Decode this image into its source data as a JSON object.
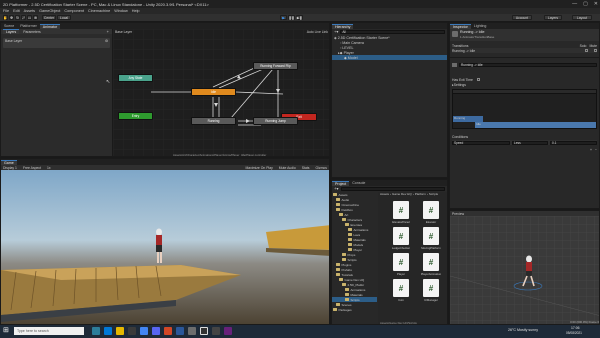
{
  "window": {
    "title": "2D Platformer - 2.5D Certification Starter Scene - PC, Mac & Linux Standalone - Unity 2020.3.9f1 Personal* <DX11>",
    "controls": [
      "—",
      "▢",
      "✕"
    ]
  },
  "menu": [
    "File",
    "Edit",
    "Assets",
    "GameObject",
    "Component",
    "Cinemachine",
    "Window",
    "Help"
  ],
  "toolbar": {
    "pivot": "Center",
    "space": "Local",
    "account": "Account",
    "layers": "Layers",
    "layout": "Layout"
  },
  "animator": {
    "tabs": [
      "Scene",
      "Platformer",
      "Animator"
    ],
    "subtabs": [
      "Layers",
      "Parameters"
    ],
    "base_layer_breadcrumb": "Base Layer",
    "layer_item": "Base Layer",
    "auto_live_link": "Auto Live Link",
    "path": "Assets/Art/Character/Animations/Player/Anims/Player_Idle/Player.controller",
    "states": {
      "any_state": "Any State",
      "entry": "Entry",
      "idle": "Idle",
      "exit": "Exit",
      "running": "Running",
      "running_jump": "Running Jump",
      "running_forward_flip": "Running Forward Flip"
    }
  },
  "hierarchy": {
    "tab": "Hierarchy",
    "search_placeholder": "All",
    "scene": "2.5D Certification Starter Scene*",
    "items": [
      "Main Camera",
      "LEVEL",
      "Player",
      "Model"
    ]
  },
  "inspector": {
    "tabs": [
      "Inspector",
      "Lighting"
    ],
    "header": "Running -> Idle",
    "sub_header": "1 AnimatorTransitionBase",
    "transitions_label": "Transitions",
    "solo_label": "Solo",
    "mute_label": "Mute",
    "transition_item": "Running -> Idle",
    "name_field": "Running -> Idle",
    "has_exit_time": "Has Exit Time",
    "settings": "Settings",
    "timeline_state_a": "Running",
    "timeline_state_b": "Idle",
    "conditions_label": "Conditions",
    "condition_param": "Speed",
    "condition_op": "Less",
    "condition_value": "0.1",
    "preview_label": "Preview",
    "preview_info": "0:00 (000.0%) Frame 0"
  },
  "game": {
    "tabs": [
      "Game"
    ],
    "display": "Display 1",
    "aspect": "Free Aspect",
    "scale": "1x",
    "options": [
      "Maximize On Play",
      "Mute Audio",
      "Stats",
      "Gizmos"
    ]
  },
  "project": {
    "tabs": [
      "Project",
      "Console"
    ],
    "breadcrumb": [
      "Assets",
      "Game Dev HQ",
      "Platform",
      "Scripts"
    ],
    "tree": [
      "Assets",
      "Audio",
      "Cinemachine",
      "Fieldbox",
      "Art",
      "Characters",
      "Enemies",
      "Animations",
      "Lava",
      "Materials",
      "Models",
      "Player",
      "Props",
      "Scripts",
      "Plugins",
      "Prefabs",
      "Tutorials",
      "Game Dev HQ",
      "2.5D_Platfor",
      "Animations",
      "Materials",
      "Scripts",
      "Scenes",
      "Packages"
    ],
    "assets": [
      "ElevatorPanel",
      "Elevator",
      "LedgeChecker",
      "MovingPlatform",
      "Player",
      "PlayerAnimation",
      "Coin",
      "UIManager"
    ],
    "status_path": "Assets/Game Dev HQ/Scripts"
  },
  "preview_window": {
    "label": "Preview",
    "info": "0:00 (000.0%) Frame 0"
  },
  "taskbar": {
    "search_placeholder": "Type here to search",
    "weather": "26°C Mostly sunny",
    "time": "17:06",
    "date": "05/08/2021"
  },
  "colors": {
    "accent": "#3a79bb",
    "entry": "#2e9a2e",
    "any_state": "#4aa38c",
    "default_state": "#e08a1e",
    "exit": "#c2261f"
  }
}
